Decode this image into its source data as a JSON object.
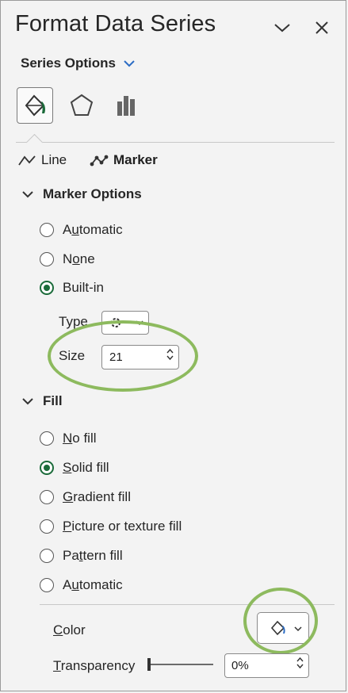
{
  "pane": {
    "title": "Format Data Series"
  },
  "series_options": {
    "label": "Series Options"
  },
  "category_tabs": [
    {
      "name": "fill-line",
      "icon": "paint-bucket-icon",
      "active": true
    },
    {
      "name": "effects",
      "icon": "pentagon-icon",
      "active": false
    },
    {
      "name": "series-options",
      "icon": "bar-chart-icon",
      "active": false
    }
  ],
  "subtabs": {
    "line": "Line",
    "marker": "Marker"
  },
  "marker_options": {
    "heading": "Marker Options",
    "radios": [
      {
        "pre": "A",
        "ul": "u",
        "post": "tomatic",
        "checked": false
      },
      {
        "pre": "N",
        "ul": "o",
        "post": "ne",
        "checked": false
      },
      {
        "pre": "B",
        "ul": "",
        "post": "uilt-in",
        "checked": true
      }
    ],
    "type_label": "Type",
    "size_label": "Size",
    "size_value": "21"
  },
  "fill": {
    "heading": "Fill",
    "radios": [
      {
        "pre": "",
        "ul": "N",
        "post": "o fill",
        "checked": false
      },
      {
        "pre": "",
        "ul": "S",
        "post": "olid fill",
        "checked": true
      },
      {
        "pre": "",
        "ul": "G",
        "post": "radient fill",
        "checked": false
      },
      {
        "pre": "",
        "ul": "P",
        "post": "icture or texture fill",
        "checked": false
      },
      {
        "pre": "Pa",
        "ul": "t",
        "post": "tern fill",
        "checked": false
      },
      {
        "pre": "A",
        "ul": "u",
        "post": "tomatic",
        "checked": false
      }
    ],
    "color_label_ul": "C",
    "color_label_rest": "olor",
    "transparency_label_ul": "T",
    "transparency_label_rest": "ransparency",
    "transparency_value": "0%"
  },
  "colors": {
    "accent_green": "#1b6b3a",
    "highlight_ellipse": "#8dba5e"
  }
}
